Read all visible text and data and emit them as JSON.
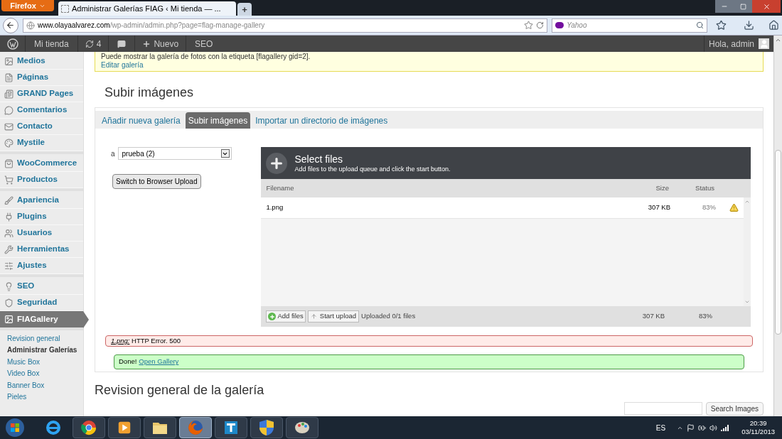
{
  "browser": {
    "menu_button": "Firefox",
    "tab_title": "Administrar Galerías FIAG ‹ Mi tienda — ...",
    "new_tab": "+",
    "url_host": "www.olayaalvarez.com",
    "url_path": "/wp-admin/admin.php?page=flag-manage-gallery",
    "search_placeholder": "Yahoo"
  },
  "admin_bar": {
    "site": "Mi tienda",
    "updates": "4",
    "new": "Nuevo",
    "seo": "SEO",
    "greeting": "Hola, admin"
  },
  "sidebar": {
    "groups": [
      [
        {
          "label": "Medios",
          "selected": false
        },
        {
          "label": "Páginas",
          "selected": false
        },
        {
          "label": "GRAND Pages",
          "selected": false
        },
        {
          "label": "Comentarios",
          "selected": false
        },
        {
          "label": "Contacto",
          "selected": false
        },
        {
          "label": "Mystile",
          "selected": false
        }
      ],
      [
        {
          "label": "WooCommerce",
          "selected": false
        },
        {
          "label": "Productos",
          "selected": false
        }
      ],
      [
        {
          "label": "Apariencia",
          "selected": false
        },
        {
          "label": "Plugins",
          "selected": false
        },
        {
          "label": "Usuarios",
          "selected": false
        },
        {
          "label": "Herramientas",
          "selected": false
        },
        {
          "label": "Ajustes",
          "selected": false
        }
      ],
      [
        {
          "label": "SEO",
          "selected": false
        },
        {
          "label": "Seguridad",
          "selected": false
        },
        {
          "label": "FIAGallery",
          "selected": true
        }
      ]
    ],
    "submenu": [
      {
        "label": "Revision general",
        "selected": false
      },
      {
        "label": "Administrar Galerías",
        "selected": true
      },
      {
        "label": "Music Box",
        "selected": false
      },
      {
        "label": "Video Box",
        "selected": false
      },
      {
        "label": "Banner Box",
        "selected": false
      },
      {
        "label": "Pieles",
        "selected": false
      }
    ]
  },
  "notice": {
    "text": "Puede mostrar la galería de fotos con la etiqueta [flagallery gid=2].",
    "link": "Editar galería"
  },
  "upload": {
    "title": "Subir imágenes",
    "tabs": [
      {
        "label": "Añadir nueva galería",
        "selected": false
      },
      {
        "label": "Subir imágenes",
        "selected": true
      },
      {
        "label": "Importar un directorio de imágenes",
        "selected": false
      }
    ],
    "gallery_prefix": "a",
    "gallery_value": "prueba (2)",
    "switch_button": "Switch to Browser Upload",
    "uploader": {
      "heading": "Select files",
      "subheading": "Add files to the upload queue and click the start button.",
      "columns": [
        "Filename",
        "Size",
        "Status"
      ],
      "files": [
        {
          "name": "1.png",
          "size": "307 KB",
          "status": "83%",
          "warning": true
        }
      ],
      "add_button": "Add files",
      "start_button": "Start upload",
      "summary": "Uploaded 0/1 files",
      "total_size": "307 KB",
      "total_status": "83%"
    },
    "error": {
      "file": "1.png:",
      "message": "HTTP Error. 500"
    },
    "done": {
      "text": "Done!",
      "link": "Open Gallery"
    }
  },
  "overview": {
    "title": "Revision general de la galería",
    "search_button": "Search Images"
  },
  "taskbar": {
    "apps": [
      {
        "kind": "ie",
        "selected": false
      },
      {
        "kind": "chrome",
        "selected": false
      },
      {
        "kind": "media",
        "selected": false
      },
      {
        "kind": "folder",
        "selected": false
      },
      {
        "kind": "firefox",
        "selected": true
      },
      {
        "kind": "editor",
        "selected": false
      },
      {
        "kind": "shield",
        "selected": false
      },
      {
        "kind": "paint",
        "selected": false
      }
    ],
    "language": "ES",
    "time": "20:39",
    "date": "03/11/2013"
  }
}
